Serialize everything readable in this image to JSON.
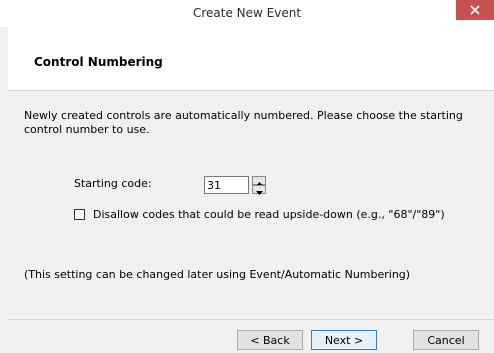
{
  "window": {
    "title": "Create New Event"
  },
  "header": {
    "title": "Control Numbering"
  },
  "content": {
    "description": "Newly created controls are automatically numbered. Please choose the starting control number to use.",
    "starting_code_label": "Starting code:",
    "starting_code_value": "31",
    "checkbox_label": "Disallow codes that could be read upside-down (e.g., \"68\"/\"89\")",
    "checkbox_checked": false,
    "note": "(This setting can be changed later using Event/Automatic Numbering)"
  },
  "buttons": {
    "back": "< Back",
    "next": "Next >",
    "cancel": "Cancel"
  },
  "icons": {
    "close": "close-icon",
    "spin_up": "arrow-up-icon",
    "spin_down": "arrow-down-icon"
  },
  "colors": {
    "close_button": "#c75050",
    "default_button_border": "#3c7fb1"
  }
}
